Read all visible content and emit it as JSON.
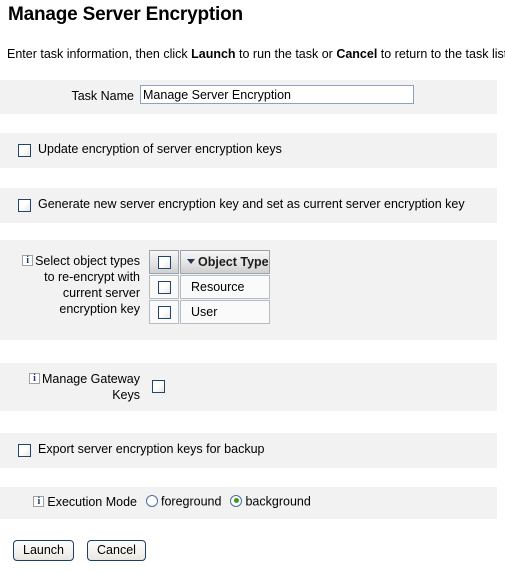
{
  "page": {
    "title": "Manage Server Encryption",
    "intro": {
      "prefix": "Enter task information, then click ",
      "bold1": "Launch",
      "middle": " to run the task or ",
      "bold2": "Cancel",
      "suffix": " to return to the task list."
    }
  },
  "task_name": {
    "label": "Task Name",
    "value": "Manage Server Encryption",
    "placeholder": ""
  },
  "options": {
    "update_encryption": {
      "label": "Update encryption of server encryption keys",
      "checked": false
    },
    "generate_new_key": {
      "label": "Generate new server encryption key and set as current server encryption key",
      "checked": false
    },
    "export_keys": {
      "label": "Export server encryption keys for backup",
      "checked": false
    }
  },
  "object_types": {
    "info_icon": "info-icon",
    "label_lines": [
      "Select object types",
      "to re-encrypt with",
      "current server",
      "encryption key"
    ],
    "select_all_checked": false,
    "header": {
      "sort_icon": "sort-descending-triangle-icon",
      "column_label": "Object Type"
    },
    "rows": [
      {
        "name": "Resource",
        "checked": false
      },
      {
        "name": "User",
        "checked": false
      }
    ]
  },
  "gateway_keys": {
    "info_icon": "info-icon",
    "label_lines": [
      "Manage Gateway",
      "Keys"
    ],
    "checked": false
  },
  "execution_mode": {
    "info_icon": "info-icon",
    "label": "Execution Mode",
    "selected": "background",
    "options": [
      {
        "value": "foreground",
        "label": "foreground",
        "checked": false
      },
      {
        "value": "background",
        "label": "background",
        "checked": true
      }
    ]
  },
  "footer": {
    "launch_label": "Launch",
    "cancel_label": "Cancel"
  },
  "colors": {
    "panel_background": "#f2f2f2",
    "page_background": "#ffffff",
    "checkbox_border": "#22456e",
    "radio_selected_dot": "#3a9b24",
    "button_border": "#1b3f6b",
    "input_border": "#8ca3bf",
    "info_icon_text": "#1c3f7a"
  }
}
